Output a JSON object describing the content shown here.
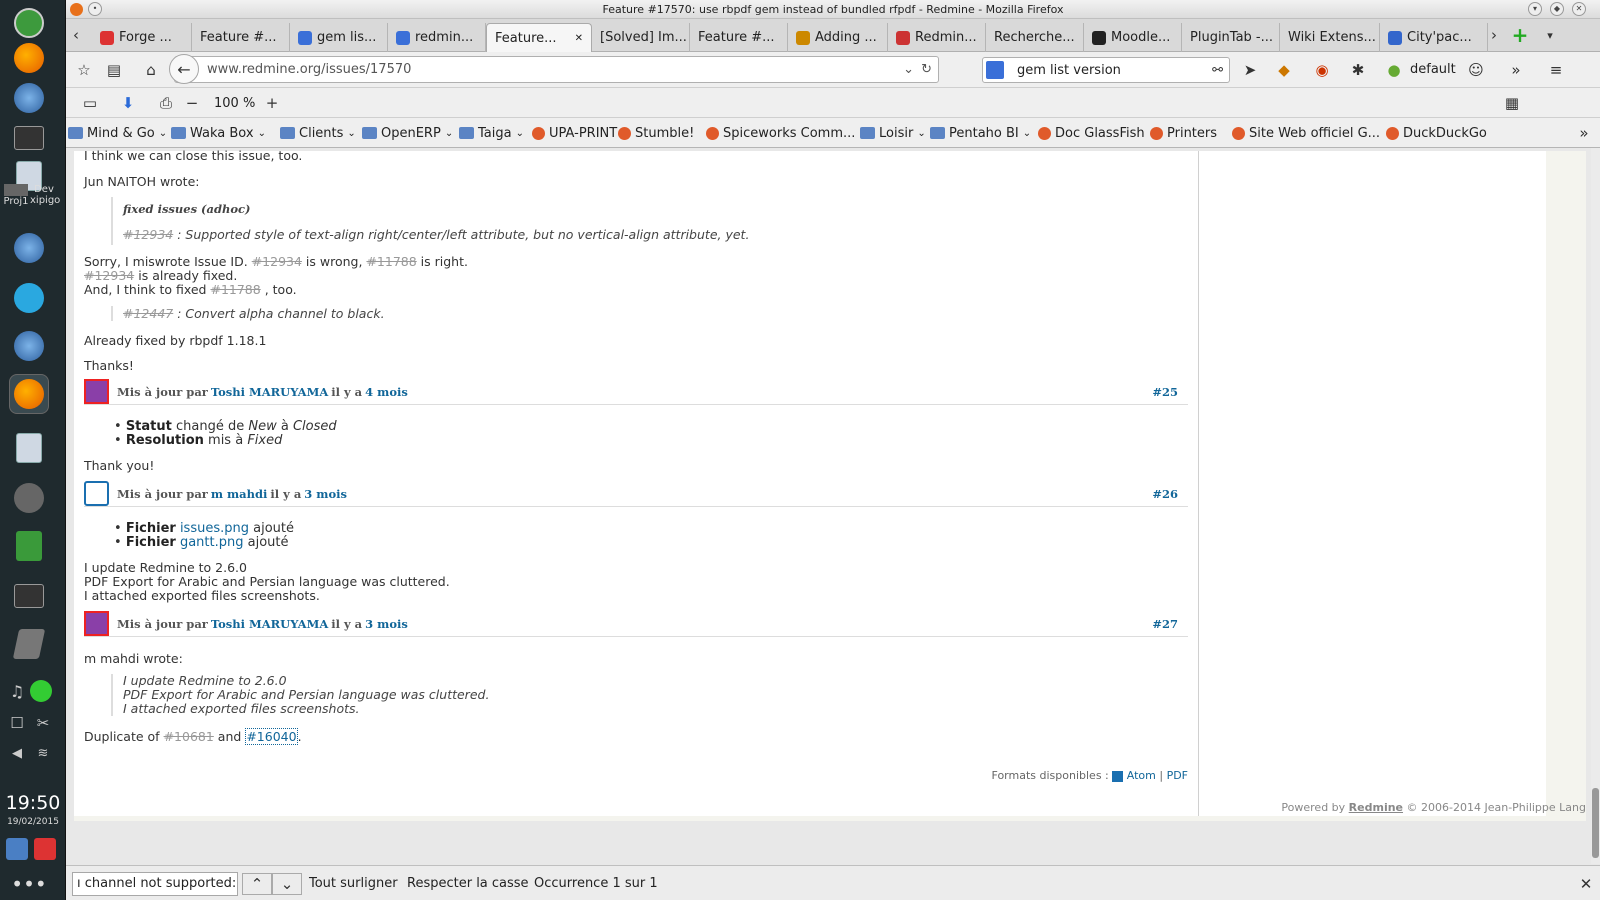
{
  "window_title": "Feature #17570: use rbpdf gem instead of bundled rfpdf - Redmine - Mozilla Firefox",
  "dock": {
    "clock": "19:50",
    "date": "19/02/2015",
    "workspaces": [
      "Proj1",
      "Dev",
      "xipigo"
    ]
  },
  "tabs": [
    {
      "label": "Forge ...",
      "icon_color": "#d33"
    },
    {
      "label": "Feature #...",
      "icon_color": ""
    },
    {
      "label": "gem lis...",
      "icon_color": "#3a6fd8"
    },
    {
      "label": "redmin...",
      "icon_color": "#3a6fd8"
    },
    {
      "label": "Feature...",
      "icon_color": "",
      "active": true
    },
    {
      "label": "[Solved] Im...",
      "icon_color": ""
    },
    {
      "label": "Feature #...",
      "icon_color": ""
    },
    {
      "label": "Adding ...",
      "icon_color": "#c80"
    },
    {
      "label": "Redmin...",
      "icon_color": "#c33"
    },
    {
      "label": "Recherche...",
      "icon_color": ""
    },
    {
      "label": "Moodle...",
      "icon_color": "#222"
    },
    {
      "label": "PluginTab -...",
      "icon_color": ""
    },
    {
      "label": "Wiki Extens...",
      "icon_color": ""
    },
    {
      "label": "City'pac...",
      "icon_color": "#36c"
    }
  ],
  "nav": {
    "url": "www.redmine.org/issues/17570",
    "search_value": "gem list version",
    "profile": "default"
  },
  "toolbar2": {
    "zoom": "100 %"
  },
  "bookmarks": [
    {
      "label": "Mind & Go",
      "type": "folder"
    },
    {
      "label": "Waka Box",
      "type": "folder"
    },
    {
      "label": "Clients",
      "type": "folder"
    },
    {
      "label": "OpenERP",
      "type": "folder"
    },
    {
      "label": "Taiga",
      "type": "folder"
    },
    {
      "label": "UPA-PRINT",
      "type": "page"
    },
    {
      "label": "Stumble!",
      "type": "page"
    },
    {
      "label": "Spiceworks Comm...",
      "type": "page"
    },
    {
      "label": "Loisir",
      "type": "folder"
    },
    {
      "label": "Pentaho BI",
      "type": "folder"
    },
    {
      "label": "Doc GlassFish",
      "type": "page"
    },
    {
      "label": "Printers",
      "type": "page"
    },
    {
      "label": "Site Web officiel G...",
      "type": "page"
    },
    {
      "label": "DuckDuckGo",
      "type": "page"
    }
  ],
  "content": {
    "line_close": "I think we can close this issue, too.",
    "jun_wrote": "Jun NAITOH wrote:",
    "q1_title": "fixed issues (adhoc)",
    "q1_ref": "#12934",
    "q1_text": ": Supported style of text-align right/center/left attribute, but no vertical-align attribute, yet.",
    "sorry_1a": "Sorry, I miswrote Issue ID.",
    "sorry_1b": "#12934",
    "sorry_1c": "is wrong,",
    "sorry_1d": "#11788",
    "sorry_1e": "is right.",
    "sorry_2a": "#12934",
    "sorry_2b": "is already fixed.",
    "sorry_3a": "And, I think to fixed",
    "sorry_3b": "#11788",
    "sorry_3c": ", too.",
    "q2_ref": "#12447",
    "q2_text": ": Convert alpha channel to black.",
    "already": "Already fixed by rbpdf 1.18.1",
    "thanks": "Thanks!",
    "j25": {
      "prefix": "Mis à jour par",
      "author": "Toshi MARUYAMA",
      "mid": "il y a",
      "ago": "4 mois",
      "num": "#25"
    },
    "j25_items": [
      {
        "field": "Statut",
        "text1": "changé de",
        "from": "New",
        "text2": "à",
        "to": "Closed"
      },
      {
        "field": "Resolution",
        "text1": "mis à",
        "to": "Fixed"
      }
    ],
    "thank_you": "Thank you!",
    "j26": {
      "prefix": "Mis à jour par",
      "author": "m mahdi",
      "mid": "il y a",
      "ago": "3 mois",
      "num": "#26"
    },
    "j26_items": [
      {
        "field": "Fichier",
        "file": "issues.png",
        "text": "ajouté"
      },
      {
        "field": "Fichier",
        "file": "gantt.png",
        "text": "ajouté"
      }
    ],
    "update_1": "I update Redmine to 2.6.0",
    "update_2": "PDF Export for Arabic and Persian language was cluttered.",
    "update_3": "I attached exported files screenshots.",
    "j27": {
      "prefix": "Mis à jour par",
      "author": "Toshi MARUYAMA",
      "mid": "il y a",
      "ago": "3 mois",
      "num": "#27"
    },
    "mahdi_wrote": "m mahdi wrote:",
    "dup_a": "Duplicate of",
    "dup_b": "#10681",
    "dup_c": "and",
    "dup_d": "#16040",
    "dup_e": ".",
    "formats": "Formats disponibles :",
    "atom": "Atom",
    "pdf": "PDF"
  },
  "footer": {
    "powered": "Powered by",
    "brand": "Redmine",
    "copy": "© 2006-2014 Jean-Philippe Lang"
  },
  "findbar": {
    "value": "ı channel not supported:",
    "highlight": "Tout surligner",
    "case": "Respecter la casse",
    "status": "Occurrence 1 sur 1"
  },
  "colors": {
    "link": "#116699",
    "accent": "#3a6fd8"
  }
}
